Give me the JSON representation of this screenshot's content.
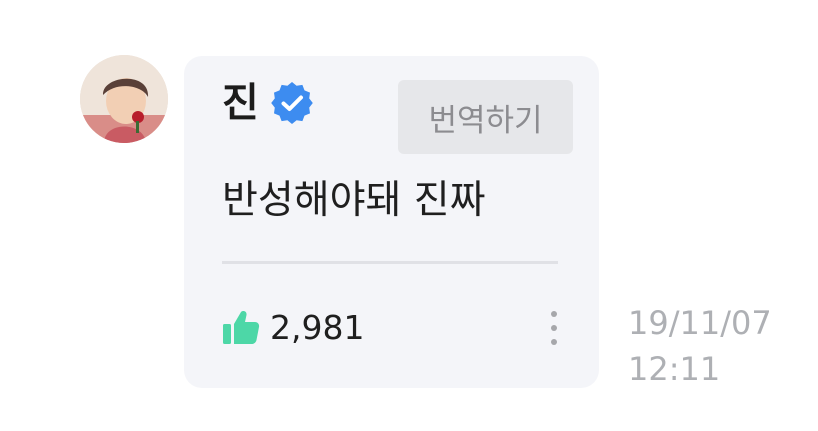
{
  "message": {
    "author": "진",
    "verified": true,
    "translate_label": "번역하기",
    "text": "반성해야돼 진짜",
    "likes": "2,981",
    "date": "19/11/07",
    "time": "12:11"
  },
  "icons": {
    "verified": "verified-badge-icon",
    "like": "thumbs-up-icon",
    "more": "more-vertical-icon"
  },
  "colors": {
    "card_background": "#f4f5f9",
    "verified_blue": "#3d8cf0",
    "like_green": "#4dd7a7",
    "timestamp_gray": "#aeb0b4"
  }
}
